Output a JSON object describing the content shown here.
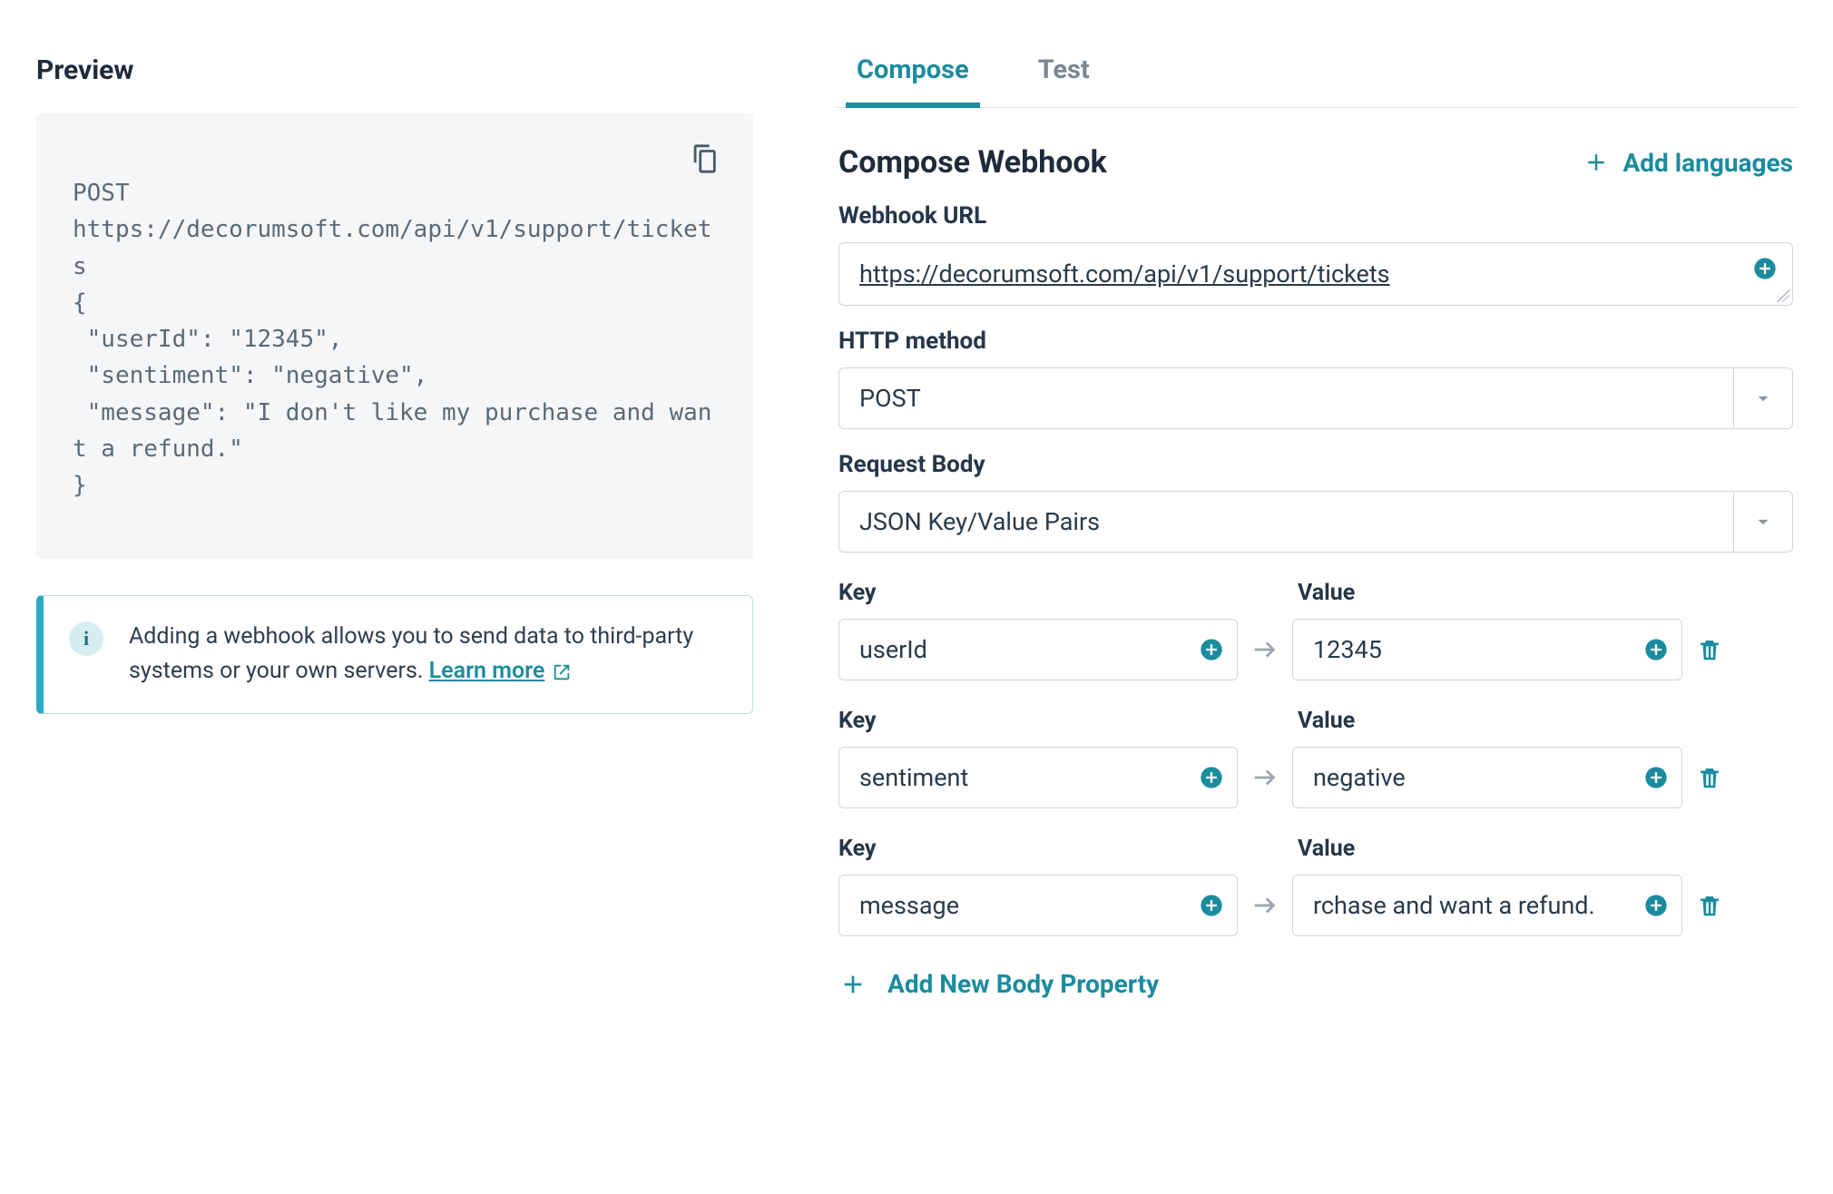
{
  "colors": {
    "teal": "#1b8c9e"
  },
  "preview": {
    "title": "Preview",
    "code": "POST\nhttps://decorumsoft.com/api/v1/support/tickets\n{\n \"userId\": \"12345\",\n \"sentiment\": \"negative\",\n \"message\": \"I don't like my purchase and want a refund.\"\n}"
  },
  "info": {
    "text": "Adding a webhook allows you to send data to third-party systems or your own servers.  ",
    "link_label": "Learn more"
  },
  "tabs": {
    "compose": "Compose",
    "test": "Test",
    "active": "compose"
  },
  "compose": {
    "heading": "Compose Webhook",
    "add_languages": "Add languages",
    "url": {
      "label": "Webhook URL",
      "value": "https://decorumsoft.com/api/v1/support/tickets"
    },
    "method": {
      "label": "HTTP method",
      "value": "POST"
    },
    "body": {
      "label": "Request Body",
      "value": "JSON Key/Value Pairs"
    },
    "kv": {
      "key_label": "Key",
      "value_label": "Value",
      "rows": [
        {
          "key": "userId",
          "value": "12345"
        },
        {
          "key": "sentiment",
          "value": "negative"
        },
        {
          "key": "message",
          "value": "I don't like my purchase and want a refund.",
          "value_display": "rchase and want a refund."
        }
      ]
    },
    "add_body_property": "Add New Body Property"
  }
}
